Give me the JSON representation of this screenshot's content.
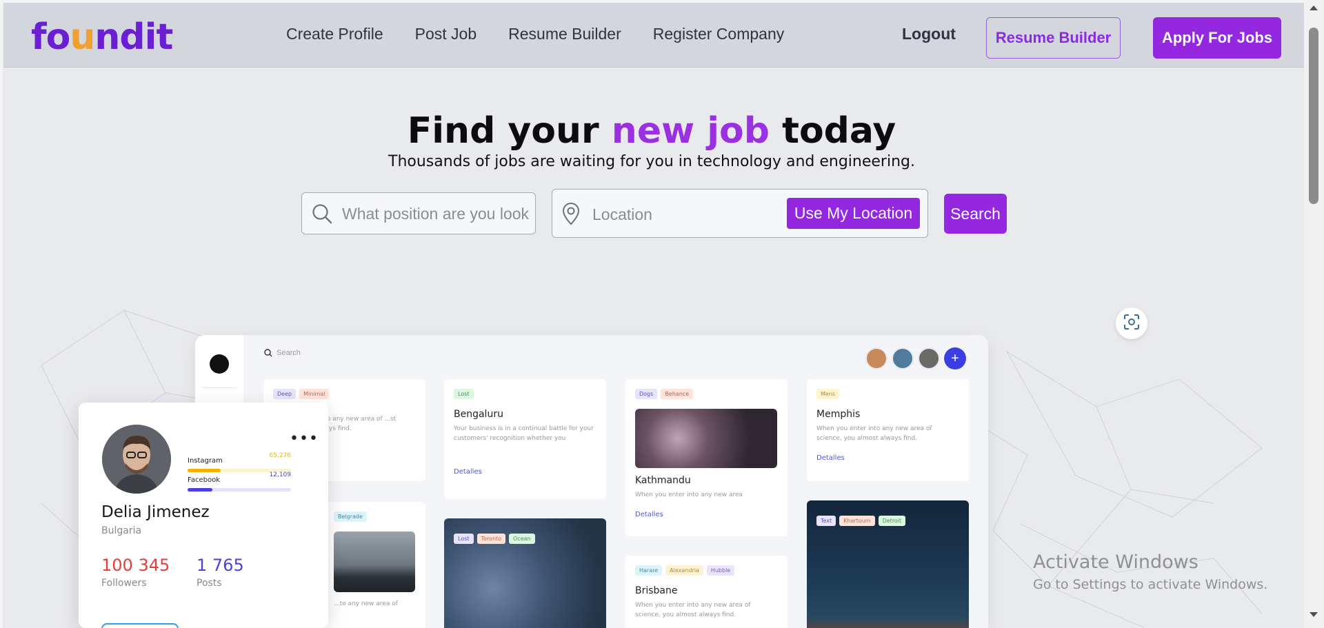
{
  "brand": {
    "logo_pre": "fo",
    "logo_u": "u",
    "logo_post": "ndit",
    "accent_color": "#9427e0"
  },
  "nav": {
    "links": [
      "Create Profile",
      "Post Job",
      "Resume Builder",
      "Register Company"
    ],
    "logout": "Logout",
    "resume_builder_btn": "Resume Builder",
    "apply_btn": "Apply For Jobs"
  },
  "hero": {
    "title_pre": "Find your ",
    "title_accent": "new job",
    "title_post": " today",
    "subtitle": "Thousands of jobs are waiting for you in technology and engineering."
  },
  "search": {
    "position_placeholder": "What position are you looking for?",
    "location_placeholder": "Location",
    "use_location_btn": "Use My Location",
    "search_btn": "Search"
  },
  "mockup": {
    "search_placeholder": "Search",
    "cards": [
      {
        "tags": [
          "Deep",
          "Minimal"
        ],
        "text": "...nto any new area of ...st always find."
      },
      {
        "tags": [
          "Lost"
        ],
        "title": "Bengaluru",
        "text": "Your business is in a continual battle for your customers' recognition whether you",
        "link": "Detalles"
      },
      {
        "tags": [
          "Dogs",
          "Behance"
        ],
        "title": "Kathmandu",
        "text": "When you enter into any new area",
        "link": "Detalles"
      },
      {
        "tags": [
          "Mens"
        ],
        "title": "Memphis",
        "text": "When you enter into any new area of science, you almost always find.",
        "link": "Detalles"
      },
      {
        "tags": [
          "Belgrade"
        ],
        "text": "...to any new area of"
      },
      {
        "tags": [
          "Lost",
          "Toronto",
          "Ocean"
        ]
      },
      {
        "tags": [
          "Harare",
          "Alexandria",
          "Hubble"
        ],
        "title": "Brisbane",
        "text": "When you enter into any new area of science, you almost always find."
      },
      {
        "tags": [
          "Text",
          "Khartoum",
          "Detroit"
        ]
      }
    ]
  },
  "profile": {
    "name": "Delia Jimenez",
    "country": "Bulgaria",
    "instagram_label": "Instagram",
    "instagram_value": "65,276",
    "facebook_label": "Facebook",
    "facebook_value": "12,109",
    "followers_value": "100 345",
    "followers_label": "Followers",
    "posts_value": "1 765",
    "posts_label": "Posts"
  },
  "watermark": {
    "line1": "Activate Windows",
    "line2": "Go to Settings to activate Windows."
  }
}
